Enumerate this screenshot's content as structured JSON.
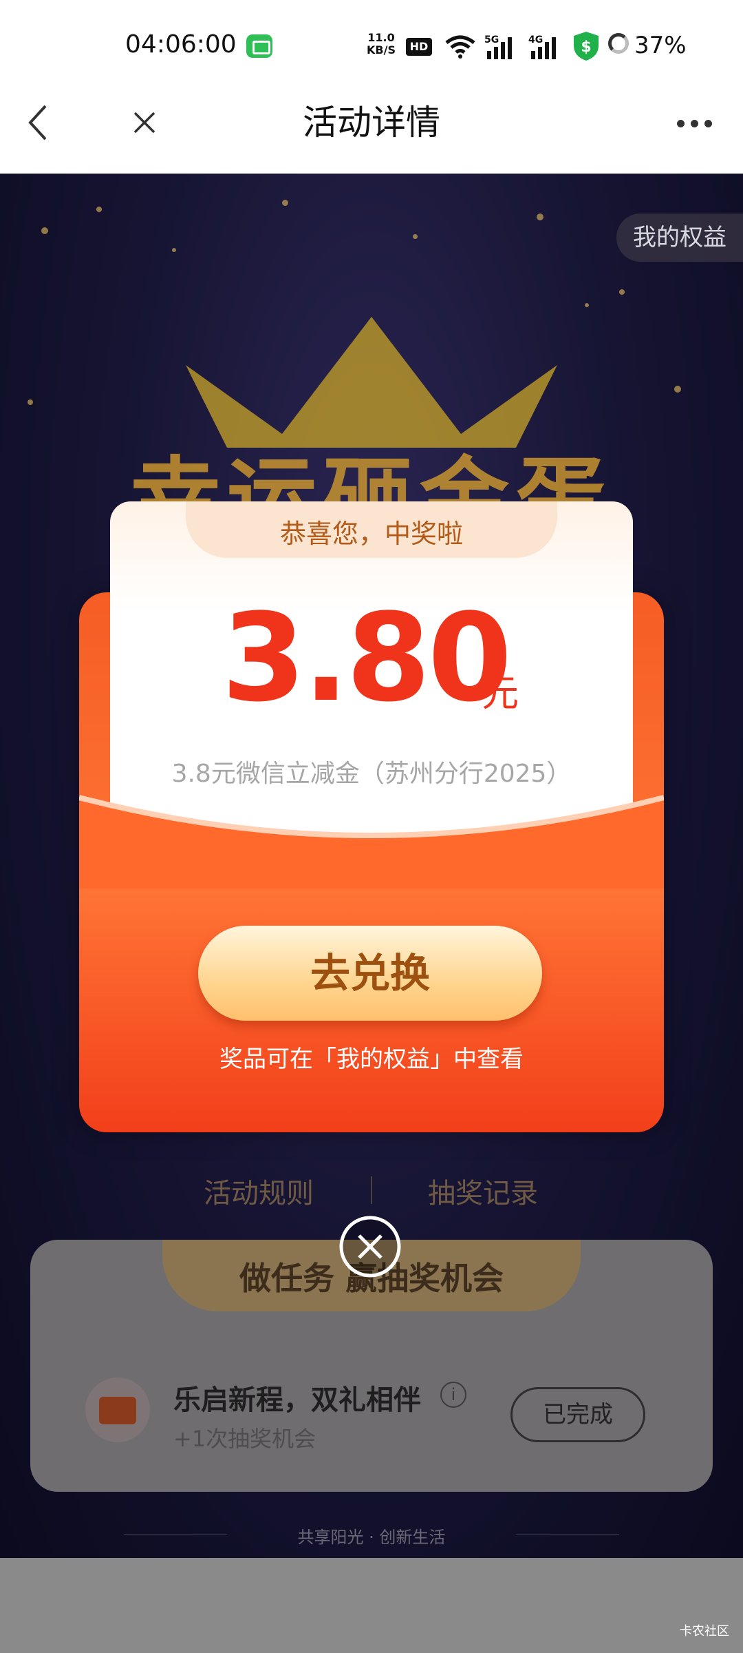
{
  "status_bar": {
    "time": "04:06:00",
    "net_speed_value": "11.0",
    "net_speed_unit": "KB/S",
    "hd_label": "HD",
    "sig1_label": "5G",
    "sig2_label": "4G",
    "battery": "37%"
  },
  "title_bar": {
    "title": "活动详情"
  },
  "page": {
    "my_rights": "我的权益",
    "game_title": "幸运砸金蛋",
    "rules_link": "活动规则",
    "records_link": "抽奖记录",
    "task_section_title": "做任务 赢抽奖机会",
    "task": {
      "title": "乐启新程，双礼相伴",
      "info": "i",
      "subtitle": "+1次抽奖机会",
      "status": "已完成"
    },
    "slogan": "共享阳光 · 创新生活",
    "corner_mark": "卡农社区"
  },
  "modal": {
    "congrats": "恭喜您，中奖啦",
    "amount": "3.80",
    "unit": "元",
    "description": "3.8元微信立减金（苏州分行2025）",
    "button_label": "去兑换",
    "hint": "奖品可在「我的权益」中查看"
  }
}
